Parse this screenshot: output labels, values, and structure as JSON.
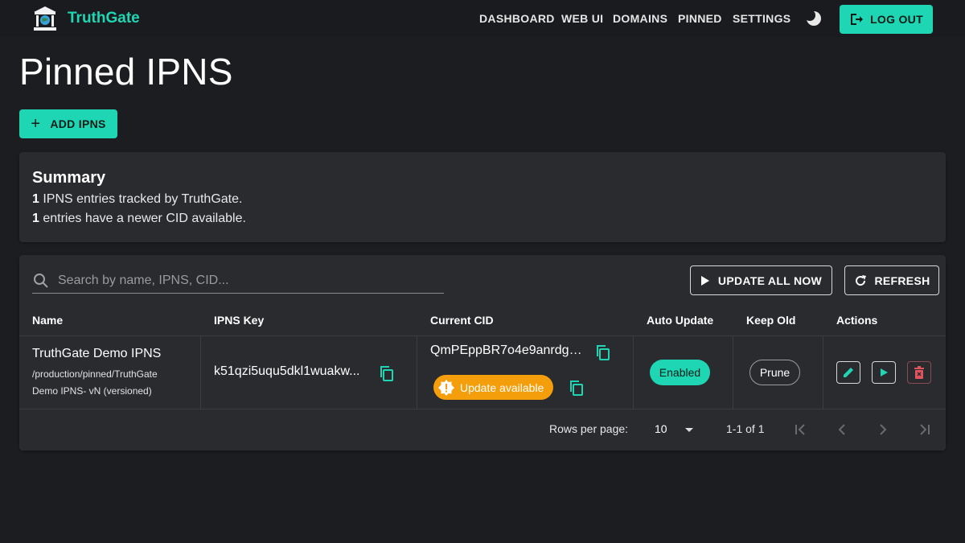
{
  "app": {
    "brand": "TruthGate",
    "accent": "#1fd6b4",
    "warning": "#f59e0b"
  },
  "nav": {
    "items": [
      "DASHBOARD",
      "WEB UI",
      "DOMAINS",
      "PINNED",
      "SETTINGS"
    ],
    "theme_icon": "moon-icon",
    "logout_label": "LOG OUT"
  },
  "page": {
    "title": "Pinned IPNS",
    "add_label": "ADD IPNS"
  },
  "summary": {
    "title": "Summary",
    "tracked_count": "1",
    "tracked_text": " IPNS entries tracked by TruthGate.",
    "newer_count": "1",
    "newer_text": " entries have a newer CID available."
  },
  "toolbar": {
    "search_placeholder": "Search by name, IPNS, CID...",
    "update_all_label": "UPDATE ALL NOW",
    "refresh_label": "REFRESH"
  },
  "table": {
    "columns": [
      "Name",
      "IPNS Key",
      "Current CID",
      "Auto Update",
      "Keep Old",
      "Actions"
    ],
    "rows": [
      {
        "name": "TruthGate Demo IPNS",
        "path": "/production/pinned/TruthGate Demo IPNS- vN (versioned)",
        "ipns_key": "k51qzi5uqu5dkl1wuakw...",
        "cid": "QmPEppBR7o4e9anrdg8...",
        "update_chip": "Update available",
        "auto_update": "Enabled",
        "keep_old": "Prune"
      }
    ]
  },
  "pagination": {
    "rows_per_page_label": "Rows per page:",
    "rows_per_page": "10",
    "range": "1-1 of 1"
  }
}
